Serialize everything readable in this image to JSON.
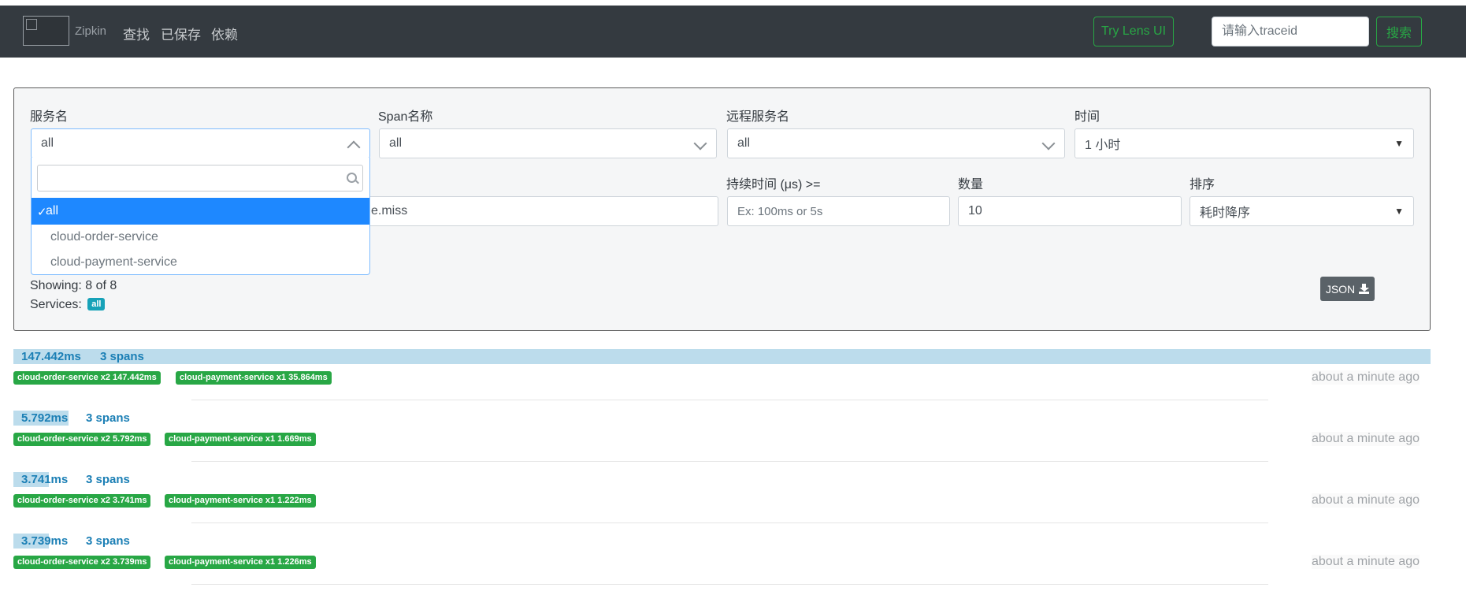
{
  "navbar": {
    "brand": "Zipkin",
    "links": [
      "查找",
      "已保存",
      "依赖"
    ],
    "lens_button": "Try Lens UI",
    "traceid_placeholder": "请输入traceid",
    "search_button": "搜索"
  },
  "filters": {
    "service_label": "服务名",
    "service_value": "all",
    "span_label": "Span名称",
    "span_value": "all",
    "remote_label": "远程服务名",
    "remote_value": "all",
    "time_label": "时间",
    "time_value": "1 小时",
    "annotation_visible_value": "e.miss",
    "duration_label": "持续时间 (μs) >=",
    "duration_placeholder": "Ex: 100ms or 5s",
    "limit_label": "数量",
    "limit_value": "10",
    "sort_label": "排序",
    "sort_value": "耗时降序"
  },
  "service_dropdown": {
    "options": [
      "all",
      "cloud-order-service",
      "cloud-payment-service"
    ],
    "selected": "all"
  },
  "results": {
    "showing": "Showing: 8 of 8",
    "services_label": "Services:",
    "services_badge": "all",
    "json_button": "JSON"
  },
  "traces": [
    {
      "duration": "147.442ms",
      "spans": "3 spans",
      "bar_fraction": 1.0,
      "services": [
        "cloud-order-service x2 147.442ms",
        "cloud-payment-service x1 35.864ms"
      ],
      "time_ago": "about a minute ago"
    },
    {
      "duration": "5.792ms",
      "spans": "3 spans",
      "bar_fraction": 0.039,
      "services": [
        "cloud-order-service x2 5.792ms",
        "cloud-payment-service x1 1.669ms"
      ],
      "time_ago": "about a minute ago"
    },
    {
      "duration": "3.741ms",
      "spans": "3 spans",
      "bar_fraction": 0.025,
      "services": [
        "cloud-order-service x2 3.741ms",
        "cloud-payment-service x1 1.222ms"
      ],
      "time_ago": "about a minute ago"
    },
    {
      "duration": "3.739ms",
      "spans": "3 spans",
      "bar_fraction": 0.025,
      "services": [
        "cloud-order-service x2 3.739ms",
        "cloud-payment-service x1 1.226ms"
      ],
      "time_ago": "about a minute ago"
    }
  ],
  "colors": {
    "navbar_bg": "#343a40",
    "accent_green": "#28a745",
    "duration_blue": "#1b7fb5",
    "bar_fill": "#bcdcec",
    "selected_option": "#1e88ff",
    "badge_teal": "#17a2b8"
  }
}
